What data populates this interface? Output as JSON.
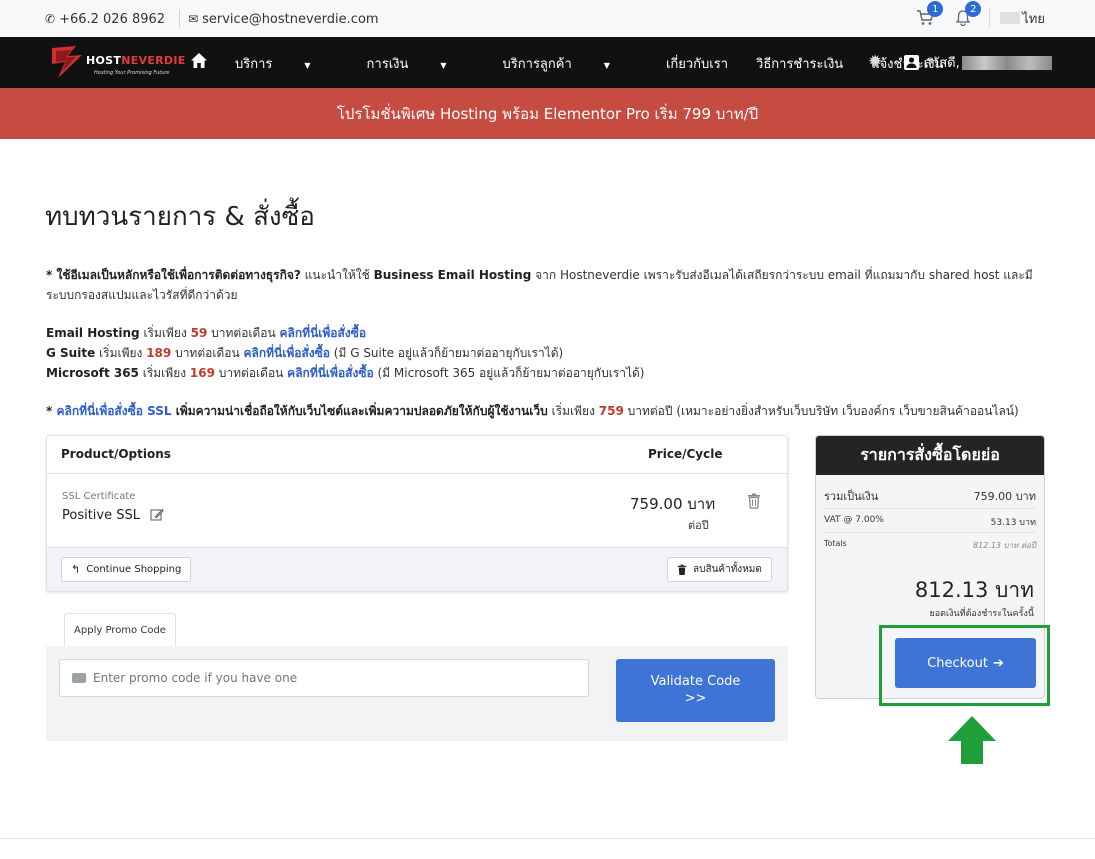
{
  "topbar": {
    "phone": "+66.2 026 8962",
    "email": "service@hostneverdie.com",
    "cart_count": "1",
    "notify_count": "2",
    "language": "ไทย"
  },
  "brand": {
    "logo_part1": "HOST",
    "logo_part2": "NEVERDIE",
    "tagline": "Hosting Your Promising Future"
  },
  "nav": {
    "items": [
      "บริการ",
      "การเงิน",
      "บริการลูกค้า",
      "เกี่ยวกับเรา",
      "วิธีการชำระเงิน",
      "แจ้งชำระเงิน"
    ],
    "greeting": "สวัสดี,"
  },
  "promo_banner": "โปรโมชั่นพิเศษ Hosting พร้อม Elementor Pro เริ่ม 799 บาท/ปี",
  "page_title": "ทบทวนรายการ & สั่งซื้อ",
  "info": {
    "p1_bold": "* ใช้อีเมลเป็นหลักหรือใช้เพื่อการติดต่อทางธุรกิจ?",
    "p1_mid": " แนะนำให้ใช้ ",
    "p1_bold2": "Business Email Hosting",
    "p1_rest": " จาก Hostneverdie เพราะรับส่งอีเมลได้เสถียรกว่าระบบ email ที่แถมมากับ shared host และมีระบบกรองสแปมและไวรัสที่ดีกว่าด้วย",
    "email_name": "Email Hosting",
    "email_start": " เริ่มเพียง ",
    "email_price": "59",
    "email_unit": " บาทต่อเดือน ",
    "email_link": "คลิกที่นี่เพื่อสั่งซื้อ",
    "gsuite_name": "G Suite",
    "gsuite_start": " เริ่มเพียง ",
    "gsuite_price": "189",
    "gsuite_unit": " บาทต่อเดือน ",
    "gsuite_link": "คลิกที่นี่เพื่อสั่งซื้อ",
    "gsuite_note": " (มี G Suite อยู่แล้วก็ย้ายมาต่ออายุกับเราได้)",
    "ms_name": "Microsoft 365",
    "ms_start": " เริ่มเพียง ",
    "ms_price": "169",
    "ms_unit": " บาทต่อเดือน ",
    "ms_link": "คลิกที่นี่เพื่อสั่งซื้อ",
    "ms_note": " (มี Microsoft 365 อยู่แล้วก็ย้ายมาต่ออายุกับเราได้)",
    "ssl_star": "* ",
    "ssl_link": "คลิกที่นี่เพื่อสั่งซื้อ SSL",
    "ssl_bold": " เพิ่มความน่าเชื่อถือให้กับเว็บไซต์และเพิ่มความปลอดภัยให้กับผู้ใช้งานเว็บ",
    "ssl_start": " เริ่มเพียง ",
    "ssl_price": "759",
    "ssl_rest": " บาทต่อปี (เหมาะอย่างยิ่งสำหรับเว็บบริษัท เว็บองค์กร เว็บขายสินค้าออนไลน์)"
  },
  "cart": {
    "col_product": "Product/Options",
    "col_price": "Price/Cycle",
    "item": {
      "category": "SSL Certificate",
      "name": "Positive SSL",
      "price": "759.00 บาท",
      "cycle": "ต่อปี"
    },
    "continue_label": "Continue Shopping",
    "empty_label": "ลบสินค้าทั้งหมด"
  },
  "promo_code": {
    "tab_label": "Apply Promo Code",
    "placeholder": "Enter promo code if you have one",
    "validate_line1": "Validate Code",
    "validate_line2": ">>"
  },
  "summary": {
    "title": "รายการสั่งซื้อโดยย่อ",
    "subtotal_label": "รวมเป็นเงิน",
    "subtotal_value": "759.00 บาท",
    "vat_label": "VAT @ 7.00%",
    "vat_value": "53.13 บาท",
    "totals_label": "Totals",
    "totals_value": "812.13 บาท ต่อปี",
    "total_due": "812.13 บาท",
    "due_label": "ยอดเงินที่ต้องชำระในครั้งนี้",
    "checkout_label": "Checkout"
  },
  "colors": {
    "accent": "#3d74d6",
    "banner": "#c64b40",
    "highlight": "#1e9f3a"
  }
}
